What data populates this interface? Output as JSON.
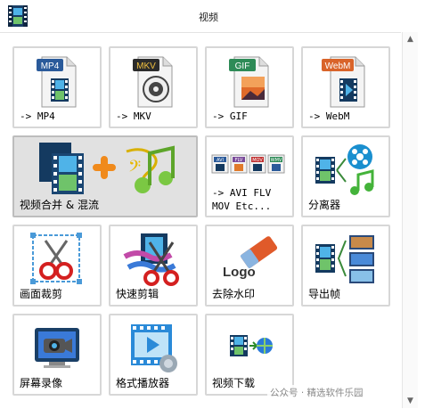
{
  "window": {
    "title": "视频"
  },
  "tiles": [
    {
      "label": "-> MP4",
      "badge": "MP4",
      "badge_color": "#2a5a9a"
    },
    {
      "label": "-> MKV",
      "badge": "MKV",
      "badge_color": "#2b2b2b"
    },
    {
      "label": "-> GIF",
      "badge": "GIF",
      "badge_color": "#2e8b57"
    },
    {
      "label": "-> WebM",
      "badge": "WebM",
      "badge_color": "#d9642a"
    },
    {
      "label": "视频合并 & 混流"
    },
    {
      "label": "-> AVI FLV\nMOV Etc...",
      "strip": [
        "AVI",
        "FLV",
        "MOV",
        "WMV"
      ]
    },
    {
      "label": "分离器"
    },
    {
      "label": "画面裁剪"
    },
    {
      "label": "快速剪辑"
    },
    {
      "label": "去除水印",
      "logo_text": "Logo"
    },
    {
      "label": "导出帧"
    },
    {
      "label": "屏幕录像"
    },
    {
      "label": "格式播放器"
    },
    {
      "label": "视频下载"
    }
  ],
  "watermark": "公众号 · 精选软件乐园"
}
